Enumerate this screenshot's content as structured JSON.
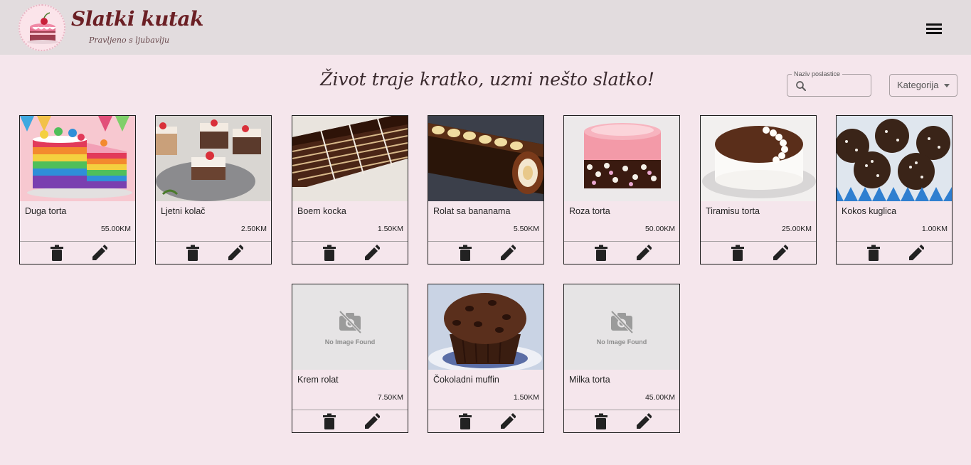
{
  "header": {
    "title": "Slatki kutak",
    "subtitle": "Pravljeno s ljubavlju"
  },
  "headline": "Život traje kratko, uzmi nešto slatko!",
  "search": {
    "label": "Naziv poslastice",
    "placeholder": "",
    "value": ""
  },
  "category": {
    "label": "Kategorija"
  },
  "no_image_text": "No Image Found",
  "colors": {
    "background": "#f5e6ec",
    "header": "#e2dcde",
    "brand": "#6b1f24"
  },
  "products": [
    {
      "name": "Duga torta",
      "price": "55.00KM",
      "image": "rainbow-cake"
    },
    {
      "name": "Ljetni kolač",
      "price": "2.50KM",
      "image": "strawberry-squares"
    },
    {
      "name": "Boem kocka",
      "price": "1.50KM",
      "image": "chocolate-layer-slices"
    },
    {
      "name": "Rolat sa bananama",
      "price": "5.50KM",
      "image": "banana-roll"
    },
    {
      "name": "Roza torta",
      "price": "50.00KM",
      "image": "pink-cake"
    },
    {
      "name": "Tiramisu torta",
      "price": "25.00KM",
      "image": "tiramisu-cake"
    },
    {
      "name": "Kokos kuglica",
      "price": "1.00KM",
      "image": "coconut-balls"
    },
    {
      "name": "Krem rolat",
      "price": "7.50KM",
      "image": "none"
    },
    {
      "name": "Čokoladni muffin",
      "price": "1.50KM",
      "image": "chocolate-muffin"
    },
    {
      "name": "Milka torta",
      "price": "45.00KM",
      "image": "none"
    }
  ]
}
